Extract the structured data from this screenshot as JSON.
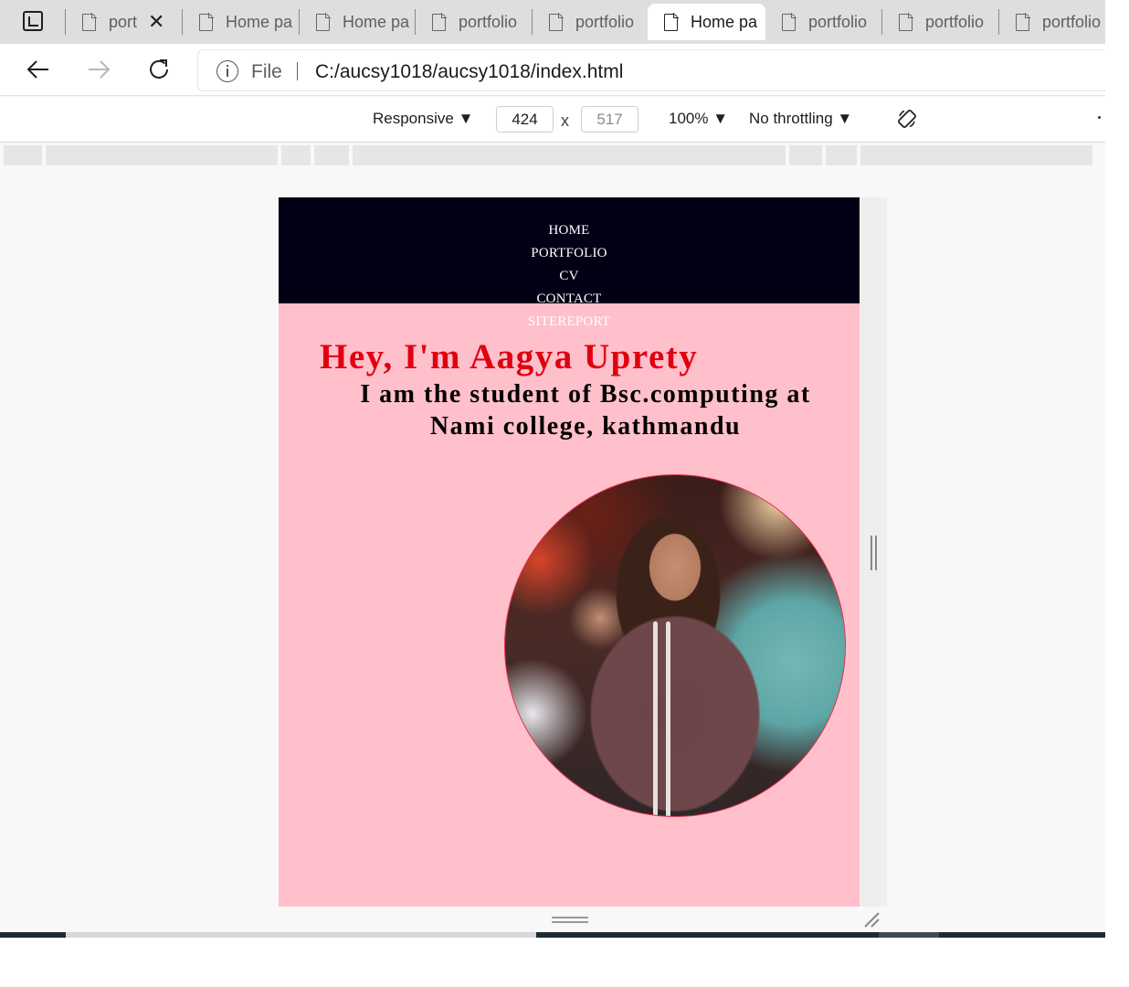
{
  "tabs": [
    {
      "title": "port",
      "active": false,
      "has_close": true
    },
    {
      "title": "Home pa",
      "active": false
    },
    {
      "title": "Home pa",
      "active": false
    },
    {
      "title": "portfolio",
      "active": false
    },
    {
      "title": "portfolio",
      "active": false
    },
    {
      "title": "Home pa",
      "active": true
    },
    {
      "title": "portfolio",
      "active": false
    },
    {
      "title": "portfolio",
      "active": false
    },
    {
      "title": "portfolio",
      "active": false
    }
  ],
  "address_bar": {
    "scheme_label": "File",
    "url": "C:/aucsy1018/aucsy1018/index.html"
  },
  "device_toolbar": {
    "device": "Responsive",
    "width": "424",
    "height": "517",
    "zoom": "100%",
    "throttling": "No throttling",
    "dimension_separator": "x"
  },
  "site": {
    "menu": [
      "HOME",
      "PORTFOLIO",
      "CV",
      "CONTACT",
      "SITEREPORT"
    ],
    "hero_title": "Hey, I'm Aagya Uprety",
    "hero_subtitle": "I am the student of Bsc.computing at Nami college, kathmandu",
    "colors": {
      "nav_bg": "#020014",
      "page_bg": "#ffc0cb",
      "title": "#e0000f",
      "subtitle": "#000000"
    }
  },
  "icons": {
    "tab_actions": "tab-actions-icon",
    "page": "page-icon",
    "close": "close-icon",
    "back": "back-arrow-icon",
    "forward": "forward-arrow-icon",
    "reload": "reload-icon",
    "info": "info-icon",
    "rotate": "rotate-icon"
  }
}
